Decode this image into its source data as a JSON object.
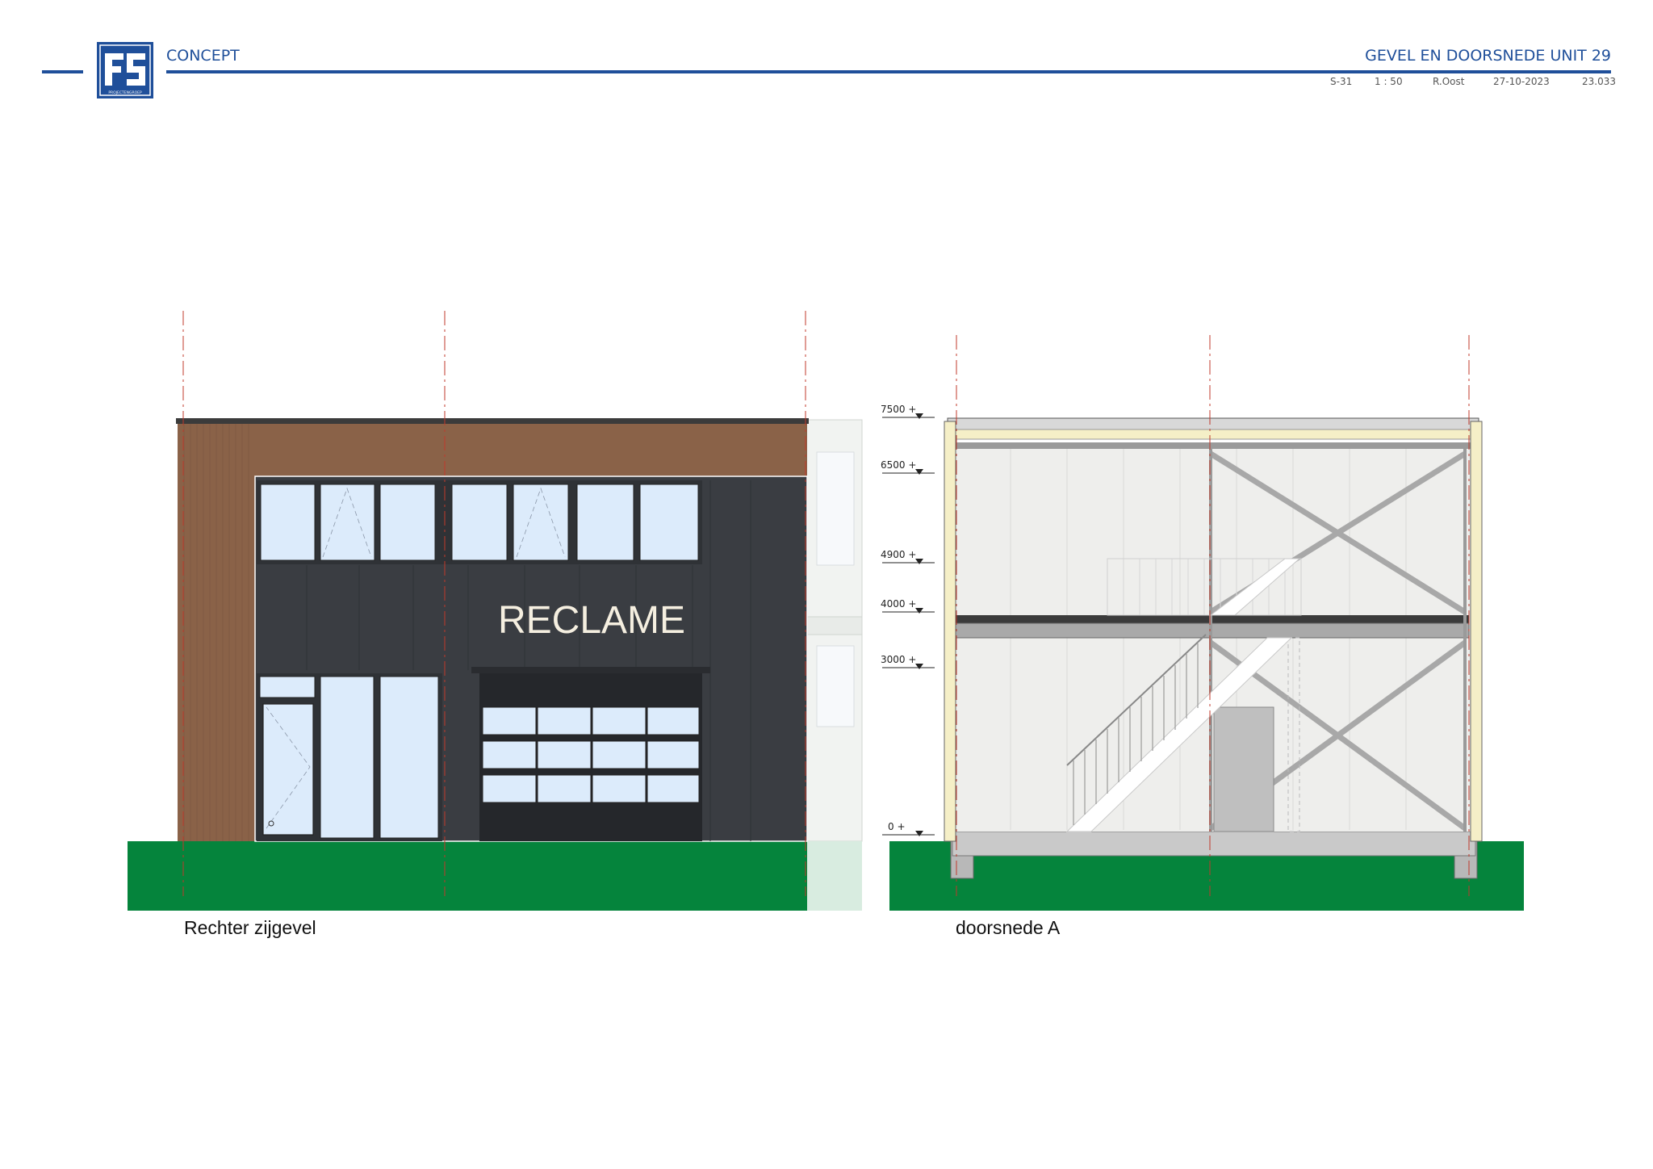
{
  "header": {
    "status": "CONCEPT",
    "title": "GEVEL EN DOORSNEDE UNIT 29",
    "logo_text": "FS",
    "logo_subtext": "PROJECTENGROEP",
    "sheet": "S-31",
    "scale": "1 : 50",
    "author": "R.Oost",
    "date": "27-10-2023",
    "project_number": "23.033"
  },
  "elevation": {
    "caption": "Rechter zijgevel",
    "sign_text": "RECLAME"
  },
  "section": {
    "caption": "doorsnede A",
    "levels": [
      "7500 +",
      "6500 +",
      "4900 +",
      "4000 +",
      "3000 +",
      "0 +"
    ]
  },
  "colors": {
    "brand_blue": "#1f4f9a",
    "wood_cladding": "#8a6248",
    "dark_panel": "#3a3d42",
    "glass": "#dcebfb",
    "ground": "#05843c",
    "grid_line": "#c0392b"
  }
}
